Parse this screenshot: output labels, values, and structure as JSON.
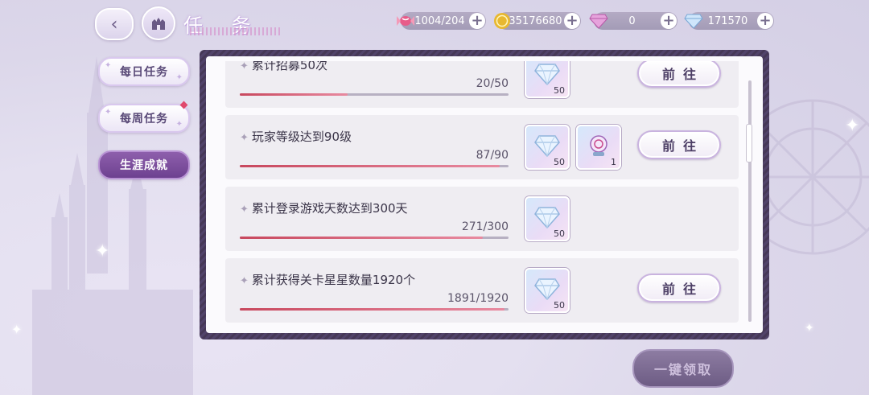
{
  "header": {
    "title": "任 务",
    "back_icon": "back-arrow-icon",
    "home_icon": "castle-home-icon"
  },
  "currencies": [
    {
      "name": "candy",
      "icon": "candy-icon",
      "value": "1004/204"
    },
    {
      "name": "coin",
      "icon": "gold-coin-icon",
      "value": "35176680"
    },
    {
      "name": "pink-diamond",
      "icon": "pink-diamond-icon",
      "value": "0"
    },
    {
      "name": "diamond",
      "icon": "diamond-icon",
      "value": "171570"
    }
  ],
  "tabs": [
    {
      "label": "每日任务",
      "active": false,
      "badge": false
    },
    {
      "label": "每周任务",
      "active": false,
      "badge": true
    },
    {
      "label": "生涯成就",
      "active": true,
      "badge": false
    }
  ],
  "tasks": [
    {
      "name": "累计招募50次",
      "progress_text": "20/50",
      "progress": 0.4,
      "rewards": [
        {
          "icon": "diamond-icon",
          "qty": "50"
        }
      ],
      "action": "前往"
    },
    {
      "name": "玩家等级达到90级",
      "progress_text": "87/90",
      "progress": 0.967,
      "rewards": [
        {
          "icon": "diamond-icon",
          "qty": "50"
        },
        {
          "icon": "crystal-ball-icon",
          "qty": "1"
        }
      ],
      "action": "前往"
    },
    {
      "name": "累计登录游戏天数达到300天",
      "progress_text": "271/300",
      "progress": 0.903,
      "rewards": [
        {
          "icon": "diamond-icon",
          "qty": "50"
        }
      ],
      "action": ""
    },
    {
      "name": "累计获得关卡星星数量1920个",
      "progress_text": "1891/1920",
      "progress": 0.985,
      "rewards": [
        {
          "icon": "diamond-icon",
          "qty": "50"
        }
      ],
      "action": "前往"
    }
  ],
  "footer": {
    "claim_all_label": "一键领取"
  },
  "colors": {
    "progress": "#c8485e",
    "active_tab": "#7a4c9c",
    "panel_frame": "#4a3c5c"
  }
}
